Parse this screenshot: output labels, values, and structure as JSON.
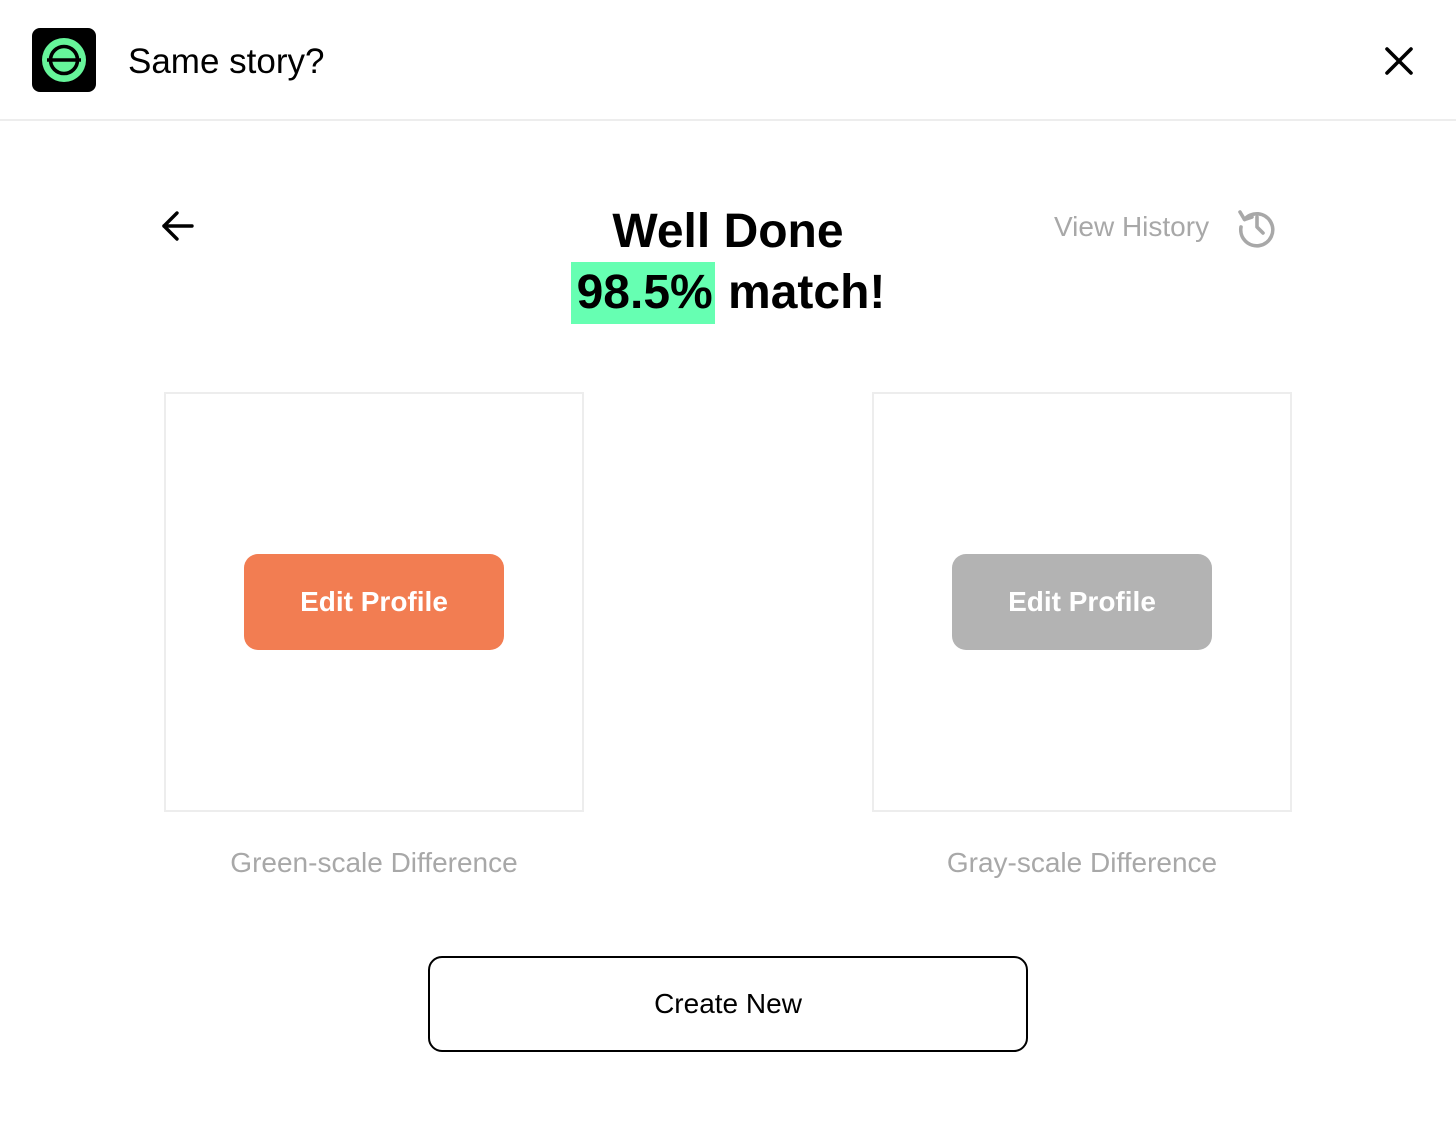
{
  "header": {
    "title": "Same story?",
    "logo_icon": "circle-e-logo-icon",
    "close_icon": "close-icon"
  },
  "result": {
    "headline": "Well Done",
    "match_percent": "98.5%",
    "match_suffix": "match!",
    "back_icon": "arrow-left-icon"
  },
  "history": {
    "label": "View History",
    "icon": "history-icon"
  },
  "panels": [
    {
      "button_label": "Edit Profile",
      "caption": "Green-scale Difference",
      "button_color": "#f27d52"
    },
    {
      "button_label": "Edit Profile",
      "caption": "Gray-scale Difference",
      "button_color": "#b3b3b3"
    }
  ],
  "actions": {
    "create_new_label": "Create New"
  },
  "colors": {
    "accent_green": "#66ffb2",
    "muted_text": "#a8a8a8",
    "divider": "#ededed"
  }
}
